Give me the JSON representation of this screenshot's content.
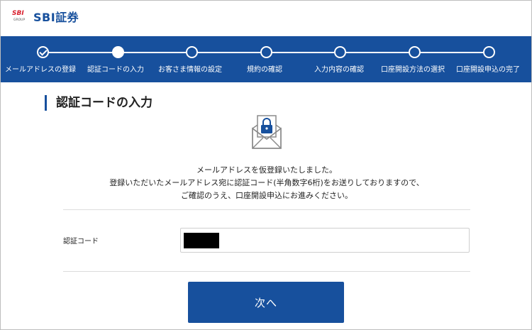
{
  "header": {
    "logo_mark_text": "SBI",
    "logo_sub": "GROUP",
    "brand": "SBI証券"
  },
  "steps": [
    {
      "label": "メールアドレスの登録",
      "state": "done"
    },
    {
      "label": "認証コードの入力",
      "state": "current"
    },
    {
      "label": "お客さま情報の設定",
      "state": "todo"
    },
    {
      "label": "規約の確認",
      "state": "todo"
    },
    {
      "label": "入力内容の確認",
      "state": "todo"
    },
    {
      "label": "口座開設方法の選択",
      "state": "todo"
    },
    {
      "label": "口座開設申込の完了",
      "state": "todo"
    }
  ],
  "main": {
    "title": "認証コードの入力",
    "icon": "lock-envelope-icon",
    "message_lines": [
      "メールアドレスを仮登録いたしました。",
      "登録いただいたメールアドレス宛に認証コード(半角数字6桁)をお送りしておりますので、",
      "ご確認のうえ、口座開設申込にお進みください。"
    ],
    "code_label": "認証コード",
    "next_label": "次へ"
  },
  "colors": {
    "brand_blue": "#17509d",
    "logo_red": "#d81e2c"
  }
}
